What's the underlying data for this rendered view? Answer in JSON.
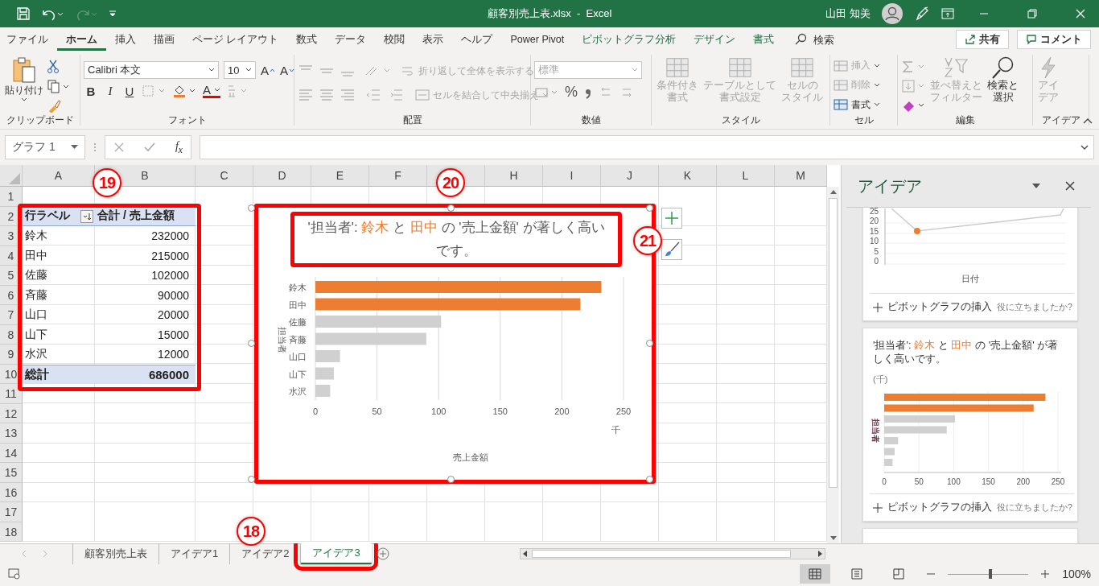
{
  "title_bar": {
    "title": "顧客別売上表.xlsx  -  Excel",
    "user": "山田 知美"
  },
  "menu_tabs": [
    {
      "label": "ファイル",
      "selected": false,
      "contextual": false
    },
    {
      "label": "ホーム",
      "selected": true,
      "contextual": false
    },
    {
      "label": "挿入",
      "selected": false,
      "contextual": false
    },
    {
      "label": "描画",
      "selected": false,
      "contextual": false
    },
    {
      "label": "ページ レイアウト",
      "selected": false,
      "contextual": false
    },
    {
      "label": "数式",
      "selected": false,
      "contextual": false
    },
    {
      "label": "データ",
      "selected": false,
      "contextual": false
    },
    {
      "label": "校閲",
      "selected": false,
      "contextual": false
    },
    {
      "label": "表示",
      "selected": false,
      "contextual": false
    },
    {
      "label": "ヘルプ",
      "selected": false,
      "contextual": false
    },
    {
      "label": "Power Pivot",
      "selected": false,
      "contextual": false
    },
    {
      "label": "ピボットグラフ分析",
      "selected": false,
      "contextual": true
    },
    {
      "label": "デザイン",
      "selected": false,
      "contextual": true
    },
    {
      "label": "書式",
      "selected": false,
      "contextual": true
    }
  ],
  "search": {
    "placeholder": "検索"
  },
  "share_button": "共有",
  "comment_button": "コメント",
  "ribbon": {
    "clipboard": {
      "label": "クリップボード",
      "paste": "貼り付け"
    },
    "font": {
      "label": "フォント",
      "font_name": "Calibri 本文",
      "font_size": "10",
      "size_buttons": [
        "A",
        "A"
      ],
      "format_buttons": [
        "B",
        "I",
        "U"
      ],
      "font_color": "A"
    },
    "alignment": {
      "label": "配置",
      "wrap": {
        "label": "折り返して全体を表示する",
        "disabled": true
      },
      "merge": {
        "label": "セルを結合して中央揃え",
        "disabled": true
      }
    },
    "number": {
      "label": "数値",
      "format": "標準",
      "percent": "%",
      "disabled": true
    },
    "styles": {
      "label": "スタイル",
      "buttons": [
        {
          "lines": [
            "条件付き",
            "書式"
          ],
          "disabled": true
        },
        {
          "lines": [
            "テーブルとして",
            "書式設定"
          ],
          "disabled": true
        },
        {
          "lines": [
            "セルの",
            "スタイル"
          ],
          "disabled": true
        }
      ]
    },
    "cells": {
      "label": "セル",
      "buttons": [
        {
          "label": "挿入",
          "disabled": true
        },
        {
          "label": "削除",
          "disabled": true
        },
        {
          "label": "書式",
          "disabled": false
        }
      ]
    },
    "editing": {
      "label": "編集",
      "buttons": [
        {
          "lines": [
            "並べ替えと",
            "フィルター"
          ],
          "disabled": true
        },
        {
          "lines": [
            "検索と",
            "選択"
          ],
          "disabled": false
        }
      ]
    },
    "ideas": {
      "label": "アイデア",
      "button": {
        "lines": [
          "アイ",
          "デア"
        ],
        "disabled": true
      }
    }
  },
  "formula_bar": {
    "name_box": "グラフ 1",
    "function_button": "f$_{x}$"
  },
  "sheet": {
    "columns": [
      {
        "label": "A"
      },
      {
        "label": "B"
      },
      {
        "label": "C"
      },
      {
        "label": "D"
      },
      {
        "label": "E"
      },
      {
        "label": "F"
      },
      {},
      {
        "label": "H"
      },
      {
        "label": "I"
      },
      {
        "label": "J"
      },
      {
        "label": "K"
      },
      {
        "label": "L"
      },
      {
        "label": "M"
      }
    ],
    "row_numbers": [
      "1",
      "2",
      "3",
      "4",
      "5",
      "6",
      "7",
      "8",
      "9",
      "10",
      "11",
      "12",
      "13",
      "14",
      "15",
      "16",
      "17",
      "18"
    ]
  },
  "pivot": {
    "highlighted": true,
    "header": {
      "label": "行ラベル",
      "value": "合計 / 売上金額"
    },
    "rows": [
      {
        "label": "鈴木",
        "value": "232000"
      },
      {
        "label": "田中",
        "value": "215000"
      },
      {
        "label": "佐藤",
        "value": "102000"
      },
      {
        "label": "斉藤",
        "value": "90000"
      },
      {
        "label": "山口",
        "value": "20000"
      },
      {
        "label": "山下",
        "value": "15000"
      },
      {
        "label": "水沢",
        "value": "12000"
      }
    ],
    "total": {
      "label": "総計",
      "value": "686000"
    }
  },
  "chart": {
    "highlighted": true,
    "title_highlighted": true,
    "title_parts": [
      {
        "text": "'担当者': ",
        "emphasis": false
      },
      {
        "text": "鈴木",
        "emphasis": true
      },
      {
        "text": " と ",
        "emphasis": false
      },
      {
        "text": "田中",
        "emphasis": true
      },
      {
        "text": " の '売上金額' が著しく高いです。",
        "emphasis": false
      }
    ],
    "unit_label": "千",
    "bars": [
      {
        "highlighted": true
      },
      {
        "highlighted": true
      },
      {
        "highlighted": false
      },
      {
        "highlighted": false
      },
      {
        "highlighted": false
      },
      {
        "highlighted": false
      },
      {
        "highlighted": false
      }
    ],
    "chart_data": {
      "type": "bar",
      "orientation": "horizontal",
      "xlabel": "売上金額",
      "ylabel": "担当者",
      "categories": [
        "鈴木",
        "田中",
        "佐藤",
        "斉藤",
        "山口",
        "山下",
        "水沢"
      ],
      "values": [
        232,
        215,
        102,
        90,
        20,
        15,
        12
      ],
      "xlim": [
        0,
        250
      ],
      "xticks": [
        0,
        50,
        100,
        150,
        200,
        250
      ],
      "grid": true
    }
  },
  "callouts": [
    {
      "label": "18"
    },
    {
      "label": "19"
    },
    {
      "label": "20"
    },
    {
      "label": "21"
    }
  ],
  "ideas_pane": {
    "title": "アイデア",
    "cards": [
      {
        "kind": "line",
        "yticks": [
          "25",
          "20",
          "15",
          "10",
          "5",
          "0"
        ],
        "xlabel": "日付",
        "insert_button": "ピボットグラフの挿入",
        "feedback": "役に立ちましたか?"
      },
      {
        "kind": "bar",
        "title_parts": [
          {
            "text": "'担当者': ",
            "emphasis": false
          },
          {
            "text": "鈴木",
            "emphasis": true
          },
          {
            "text": " と ",
            "emphasis": false
          },
          {
            "text": "田中",
            "emphasis": true
          },
          {
            "text": " の '売上金額' が著しく高いです。",
            "emphasis": false
          }
        ],
        "unit": "(千)",
        "bars": [
          {
            "highlighted": true
          },
          {
            "highlighted": true
          },
          {
            "highlighted": false
          },
          {
            "highlighted": false
          },
          {
            "highlighted": false
          },
          {
            "highlighted": false
          },
          {
            "highlighted": false
          }
        ],
        "chart_data": {
          "type": "bar",
          "orientation": "horizontal",
          "ylabel": "担当者",
          "values": [
            232,
            215,
            102,
            90,
            20,
            15,
            12
          ],
          "xlim": [
            0,
            250
          ],
          "xticks": [
            0,
            50,
            100,
            150,
            200,
            250
          ],
          "grid": true
        },
        "insert_button": "ピボットグラフの挿入",
        "feedback": "役に立ちましたか?"
      },
      {
        "kind": "partial"
      }
    ]
  },
  "sheet_tabs": [
    {
      "label": "顧客別売上表",
      "selected": false,
      "highlighted": false
    },
    {
      "label": "アイデア1",
      "selected": false,
      "highlighted": false
    },
    {
      "label": "アイデア2",
      "selected": false,
      "highlighted": false
    },
    {
      "label": "アイデア3",
      "selected": true,
      "highlighted": true
    }
  ],
  "status_bar": {
    "zoom": "100%",
    "zoom_slider": {
      "level": 0.53
    },
    "views": [
      {
        "kind": "normal",
        "selected": true
      },
      {
        "kind": "page_layout",
        "selected": false
      },
      {
        "kind": "page_break",
        "selected": false
      }
    ]
  }
}
